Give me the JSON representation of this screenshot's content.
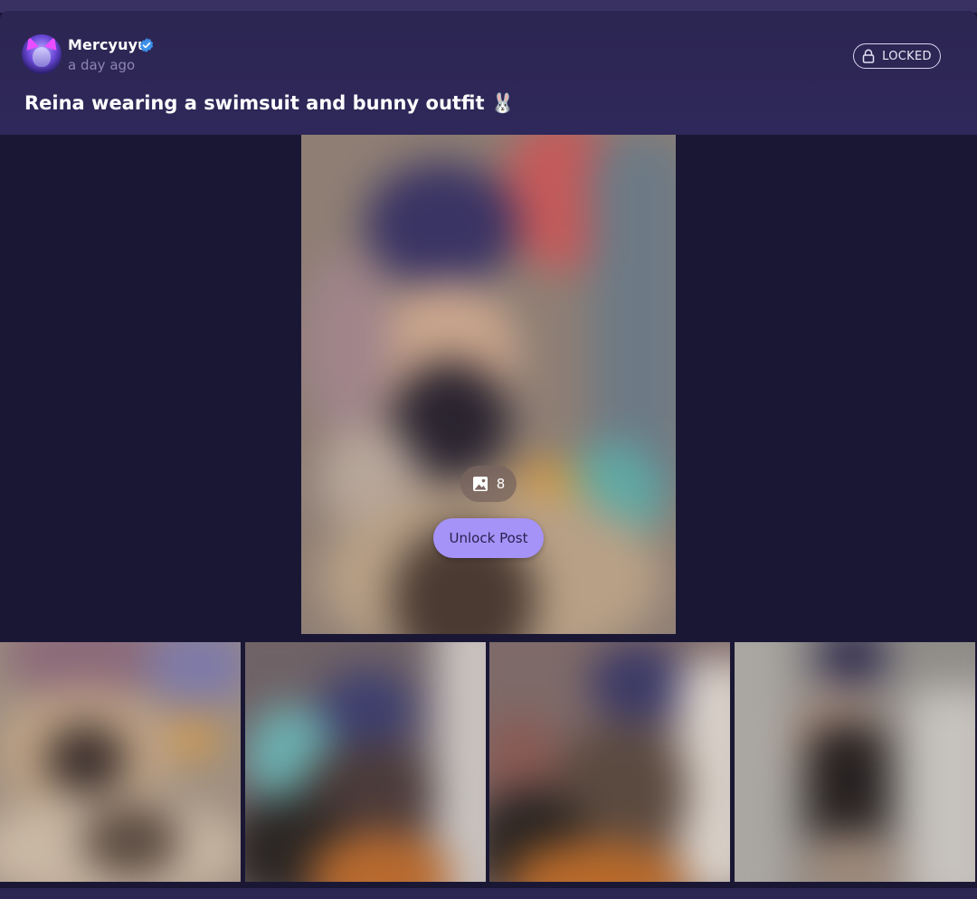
{
  "post": {
    "author": {
      "name": "Mercyuyu",
      "verified": true,
      "time": "a day ago"
    },
    "status_badge": "LOCKED",
    "title": "Reina wearing a swimsuit and bunny outfit 🐰",
    "media_count": "8",
    "unlock_label": "Unlock Post"
  },
  "icons": {
    "verified": "verified-check-icon",
    "lock": "lock-icon",
    "image": "image-icon"
  },
  "colors": {
    "header_bg": "#2c2652",
    "page_bg": "#1b1838",
    "accent_button": "#a593f7",
    "verified_blue": "#3d8fe8"
  }
}
